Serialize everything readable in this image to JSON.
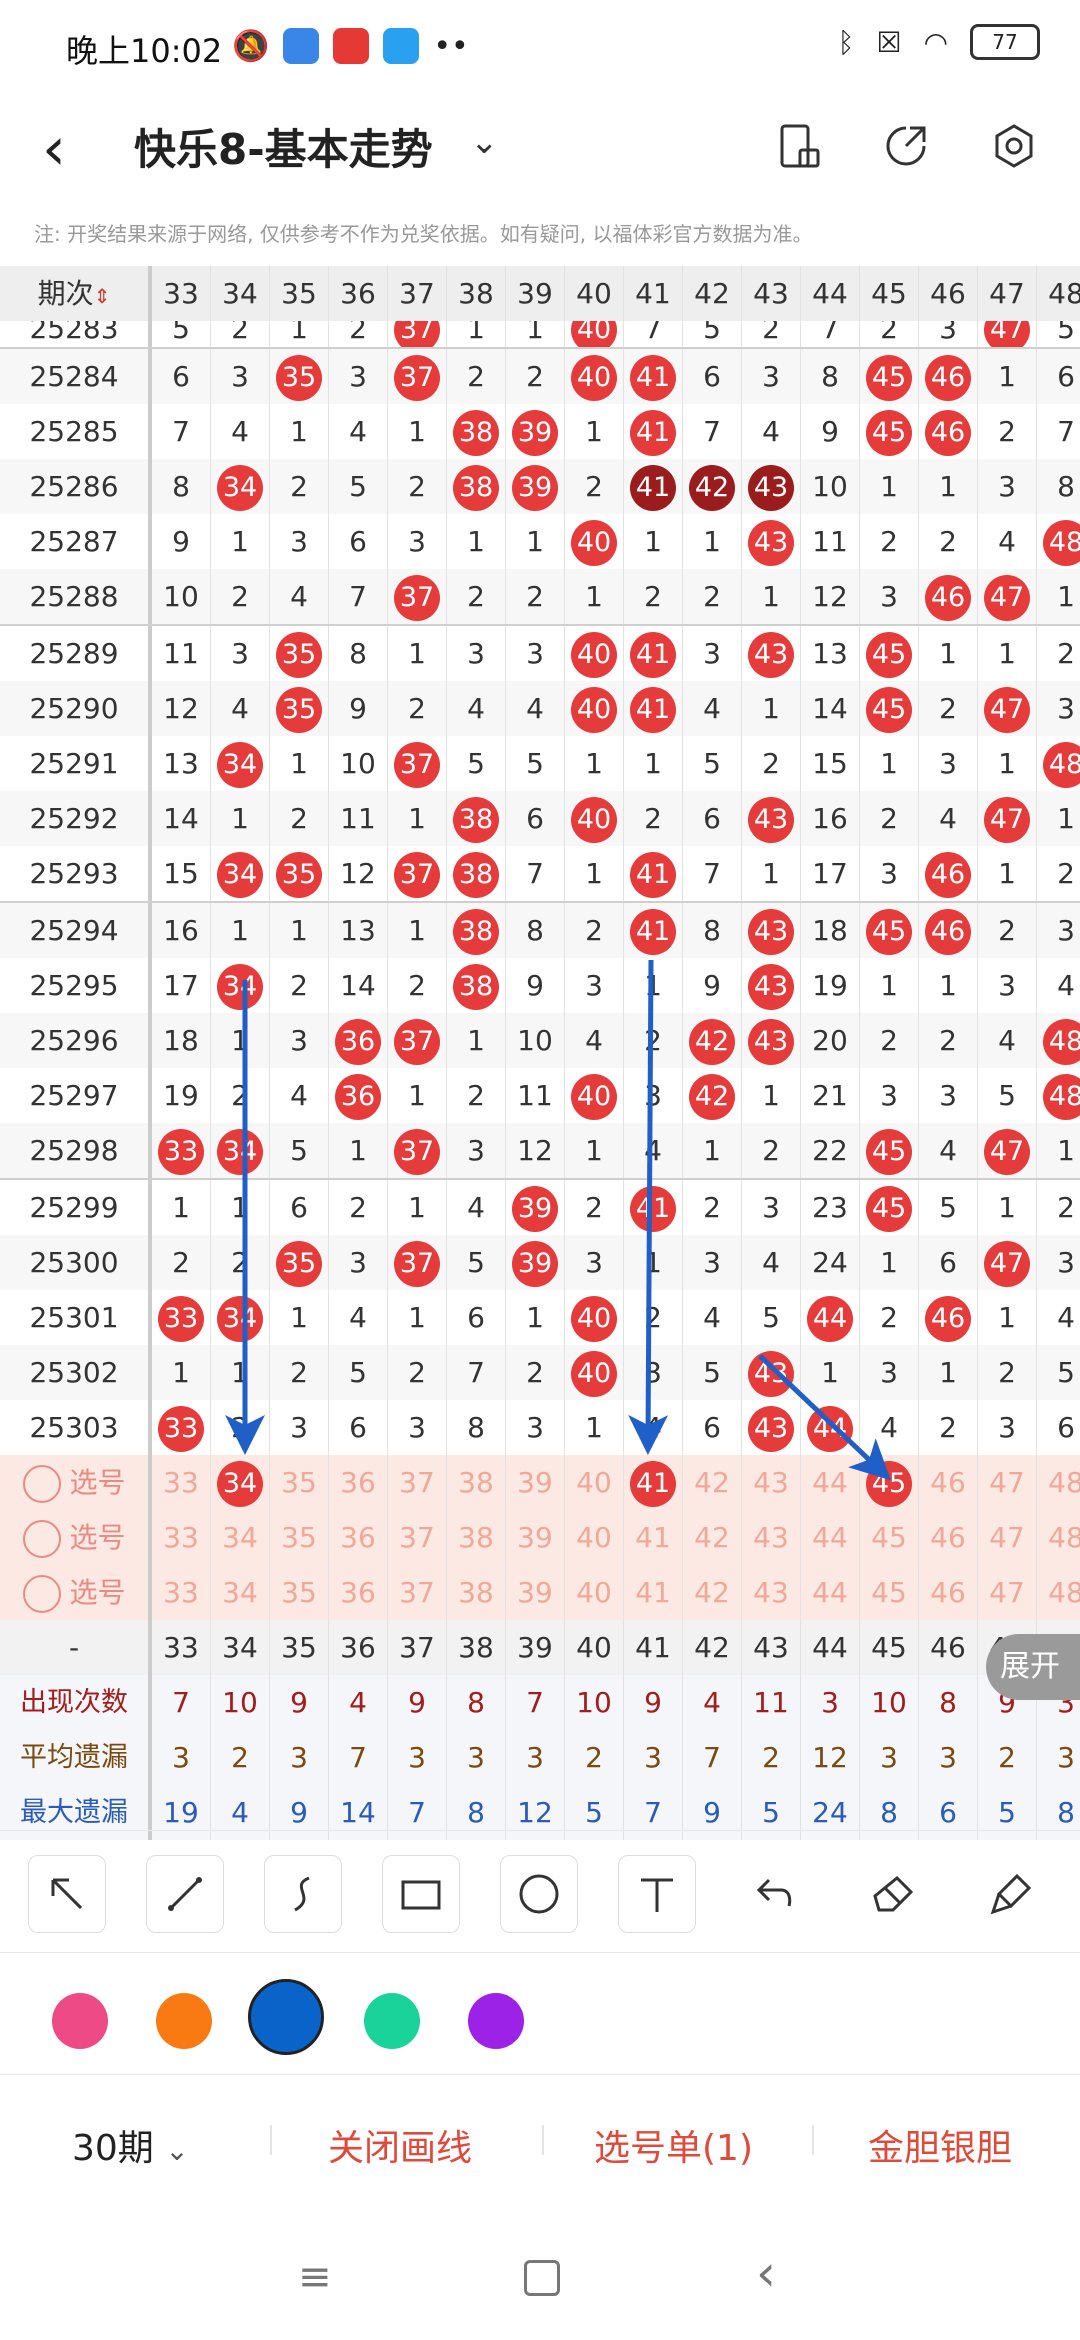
{
  "status": {
    "time": "晚上10:02",
    "battery": "77"
  },
  "nav": {
    "title": "快乐8-基本走势"
  },
  "note": "注: 开奖结果来源于网络, 仅供参考不作为兑奖依据。如有疑问, 以福体彩官方数据为准。",
  "table": {
    "first_header": "期次",
    "columns": [
      "33",
      "34",
      "35",
      "36",
      "37",
      "38",
      "39",
      "40",
      "41",
      "42",
      "43",
      "44",
      "45",
      "46",
      "47",
      "48"
    ],
    "rows": [
      {
        "period": "25283",
        "cells": [
          "5",
          "2",
          "1",
          "2",
          "37",
          "1",
          "1",
          "40",
          "7",
          "5",
          "2",
          "7",
          "2",
          "3",
          "47",
          "5"
        ],
        "hit": [
          4,
          7,
          14
        ],
        "dark": []
      },
      {
        "period": "25284",
        "cells": [
          "6",
          "3",
          "35",
          "3",
          "37",
          "2",
          "2",
          "40",
          "41",
          "6",
          "3",
          "8",
          "45",
          "46",
          "1",
          "6"
        ],
        "hit": [
          2,
          4,
          7,
          8,
          12,
          13
        ],
        "dark": []
      },
      {
        "period": "25285",
        "cells": [
          "7",
          "4",
          "1",
          "4",
          "1",
          "38",
          "39",
          "1",
          "41",
          "7",
          "4",
          "9",
          "45",
          "46",
          "2",
          "7"
        ],
        "hit": [
          5,
          6,
          8,
          12,
          13
        ],
        "dark": []
      },
      {
        "period": "25286",
        "cells": [
          "8",
          "34",
          "2",
          "5",
          "2",
          "38",
          "39",
          "2",
          "41",
          "42",
          "43",
          "10",
          "1",
          "1",
          "3",
          "8"
        ],
        "hit": [
          1,
          5,
          6,
          8,
          9,
          10
        ],
        "dark": [
          8,
          9,
          10
        ]
      },
      {
        "period": "25287",
        "cells": [
          "9",
          "1",
          "3",
          "6",
          "3",
          "1",
          "1",
          "40",
          "1",
          "1",
          "43",
          "11",
          "2",
          "2",
          "4",
          "48"
        ],
        "hit": [
          7,
          10,
          15
        ],
        "dark": []
      },
      {
        "period": "25288",
        "cells": [
          "10",
          "2",
          "4",
          "7",
          "37",
          "2",
          "2",
          "1",
          "2",
          "2",
          "1",
          "12",
          "3",
          "46",
          "47",
          "1"
        ],
        "hit": [
          4,
          13,
          14
        ],
        "dark": []
      },
      {
        "period": "25289",
        "cells": [
          "11",
          "3",
          "35",
          "8",
          "1",
          "3",
          "3",
          "40",
          "41",
          "3",
          "43",
          "13",
          "45",
          "1",
          "1",
          "2"
        ],
        "hit": [
          2,
          7,
          8,
          10,
          12
        ],
        "dark": []
      },
      {
        "period": "25290",
        "cells": [
          "12",
          "4",
          "35",
          "9",
          "2",
          "4",
          "4",
          "40",
          "41",
          "4",
          "1",
          "14",
          "45",
          "2",
          "47",
          "3"
        ],
        "hit": [
          2,
          7,
          8,
          12,
          14
        ],
        "dark": []
      },
      {
        "period": "25291",
        "cells": [
          "13",
          "34",
          "1",
          "10",
          "37",
          "5",
          "5",
          "1",
          "1",
          "5",
          "2",
          "15",
          "1",
          "3",
          "1",
          "48"
        ],
        "hit": [
          1,
          4,
          15
        ],
        "dark": []
      },
      {
        "period": "25292",
        "cells": [
          "14",
          "1",
          "2",
          "11",
          "1",
          "38",
          "6",
          "40",
          "2",
          "6",
          "43",
          "16",
          "2",
          "4",
          "47",
          "1"
        ],
        "hit": [
          5,
          7,
          10,
          14
        ],
        "dark": []
      },
      {
        "period": "25293",
        "cells": [
          "15",
          "34",
          "35",
          "12",
          "37",
          "38",
          "7",
          "1",
          "41",
          "7",
          "1",
          "17",
          "3",
          "46",
          "1",
          "2"
        ],
        "hit": [
          1,
          2,
          4,
          5,
          8,
          13
        ],
        "dark": []
      },
      {
        "period": "25294",
        "cells": [
          "16",
          "1",
          "1",
          "13",
          "1",
          "38",
          "8",
          "2",
          "41",
          "8",
          "43",
          "18",
          "45",
          "46",
          "2",
          "3"
        ],
        "hit": [
          5,
          8,
          10,
          12,
          13
        ],
        "dark": []
      },
      {
        "period": "25295",
        "cells": [
          "17",
          "34",
          "2",
          "14",
          "2",
          "38",
          "9",
          "3",
          "1",
          "9",
          "43",
          "19",
          "1",
          "1",
          "3",
          "4"
        ],
        "hit": [
          1,
          5,
          10
        ],
        "dark": []
      },
      {
        "period": "25296",
        "cells": [
          "18",
          "1",
          "3",
          "36",
          "37",
          "1",
          "10",
          "4",
          "2",
          "42",
          "43",
          "20",
          "2",
          "2",
          "4",
          "48"
        ],
        "hit": [
          3,
          4,
          9,
          10,
          15
        ],
        "dark": []
      },
      {
        "period": "25297",
        "cells": [
          "19",
          "2",
          "4",
          "36",
          "1",
          "2",
          "11",
          "40",
          "3",
          "42",
          "1",
          "21",
          "3",
          "3",
          "5",
          "48"
        ],
        "hit": [
          3,
          7,
          9,
          15
        ],
        "dark": []
      },
      {
        "period": "25298",
        "cells": [
          "33",
          "34",
          "5",
          "1",
          "37",
          "3",
          "12",
          "1",
          "4",
          "1",
          "2",
          "22",
          "45",
          "4",
          "47",
          "1"
        ],
        "hit": [
          0,
          1,
          4,
          12,
          14
        ],
        "dark": []
      },
      {
        "period": "25299",
        "cells": [
          "1",
          "1",
          "6",
          "2",
          "1",
          "4",
          "39",
          "2",
          "41",
          "2",
          "3",
          "23",
          "45",
          "5",
          "1",
          "2"
        ],
        "hit": [
          6,
          8,
          12
        ],
        "dark": []
      },
      {
        "period": "25300",
        "cells": [
          "2",
          "2",
          "35",
          "3",
          "37",
          "5",
          "39",
          "3",
          "1",
          "3",
          "4",
          "24",
          "1",
          "6",
          "47",
          "3"
        ],
        "hit": [
          2,
          4,
          6,
          14
        ],
        "dark": []
      },
      {
        "period": "25301",
        "cells": [
          "33",
          "34",
          "1",
          "4",
          "1",
          "6",
          "1",
          "40",
          "2",
          "4",
          "5",
          "44",
          "2",
          "46",
          "1",
          "4"
        ],
        "hit": [
          0,
          1,
          7,
          11,
          13
        ],
        "dark": []
      },
      {
        "period": "25302",
        "cells": [
          "1",
          "1",
          "2",
          "5",
          "2",
          "7",
          "2",
          "40",
          "3",
          "5",
          "43",
          "1",
          "3",
          "1",
          "2",
          "5"
        ],
        "hit": [
          7,
          10
        ],
        "dark": []
      },
      {
        "period": "25303",
        "cells": [
          "33",
          "2",
          "3",
          "6",
          "3",
          "8",
          "3",
          "1",
          "4",
          "6",
          "43",
          "44",
          "4",
          "2",
          "3",
          "6"
        ],
        "hit": [
          0,
          10,
          11
        ],
        "dark": []
      }
    ],
    "select_rows": [
      {
        "label": "选号",
        "picked": [
          1,
          8,
          12
        ]
      },
      {
        "label": "选号",
        "picked": []
      },
      {
        "label": "选号",
        "picked": []
      }
    ],
    "footer_first": "-",
    "stats": [
      {
        "label": "出现次数",
        "color": "#a31d1d",
        "values": [
          "7",
          "10",
          "9",
          "4",
          "9",
          "8",
          "7",
          "10",
          "9",
          "4",
          "11",
          "3",
          "10",
          "8",
          "9",
          "3"
        ]
      },
      {
        "label": "平均遗漏",
        "color": "#7a4a10",
        "values": [
          "3",
          "2",
          "3",
          "7",
          "3",
          "3",
          "3",
          "2",
          "3",
          "7",
          "2",
          "12",
          "3",
          "3",
          "2",
          "3"
        ]
      },
      {
        "label": "最大遗漏",
        "color": "#2a5bb8",
        "values": [
          "19",
          "4",
          "9",
          "14",
          "7",
          "8",
          "12",
          "5",
          "7",
          "9",
          "5",
          "24",
          "8",
          "6",
          "5",
          "8"
        ]
      }
    ]
  },
  "expand_label": "展开",
  "tools": [
    "arrow-tool",
    "line-tool",
    "curve-tool",
    "rect-tool",
    "circle-tool",
    "text-tool",
    "undo-tool",
    "eraser-tool",
    "clear-tool"
  ],
  "colors": [
    "#ee4a86",
    "#f97a12",
    "#0a63c9",
    "#19d39a",
    "#9b22e6"
  ],
  "bottom": {
    "period_label": "30期",
    "close_lines": "关闭画线",
    "selection": "选号单(1)",
    "golden": "金胆银胆"
  }
}
